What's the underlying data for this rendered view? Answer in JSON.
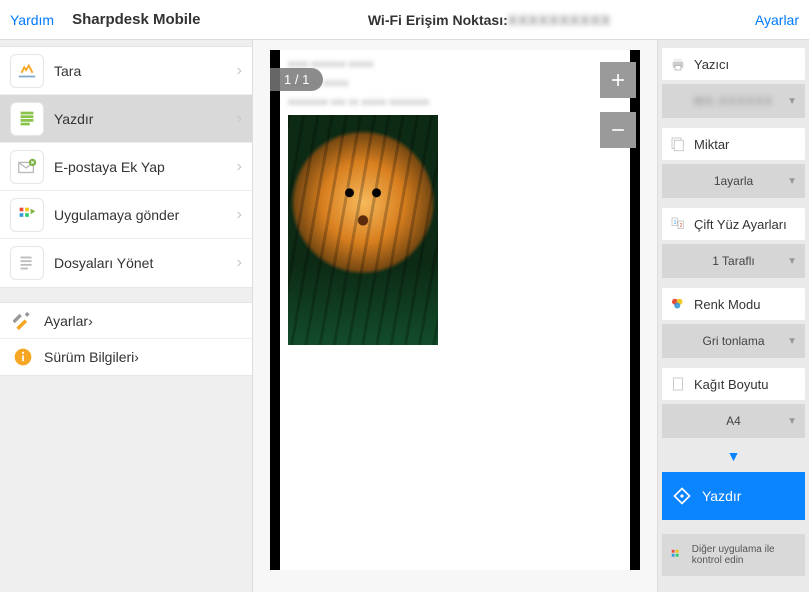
{
  "header": {
    "help": "Yardım",
    "appTitle": "Sharpdesk Mobile",
    "wifiLabel": "Wi-Fi Erişim Noktası:",
    "wifiValue": "XXXXXXXXXX",
    "settings": "Ayarlar"
  },
  "sidebar": {
    "main": [
      {
        "label": "Tara",
        "icon": "scan"
      },
      {
        "label": "Yazdır",
        "icon": "print",
        "selected": true
      },
      {
        "label": "E-postaya Ek Yap",
        "icon": "email"
      },
      {
        "label": "Uygulamaya gönder",
        "icon": "send-app"
      },
      {
        "label": "Dosyaları Yönet",
        "icon": "files"
      }
    ],
    "secondary": [
      {
        "label": "Ayarlar",
        "icon": "tools"
      },
      {
        "label": "Sürüm Bilgileri",
        "icon": "info"
      }
    ]
  },
  "preview": {
    "pageCounter": "1 / 1",
    "metaLines": [
      "xxxx xxxxxxx xxxxx",
      "xxxx xx xxxxx",
      "xxxxxxxx xxx xx xxxxx xxxxxxxx"
    ]
  },
  "settings": {
    "printer": {
      "label": "Yazıcı",
      "value": "MX-XXXXXX"
    },
    "quantity": {
      "label": "Miktar",
      "value": "1ayarla"
    },
    "duplex": {
      "label": "Çift Yüz Ayarları",
      "value": "1 Taraflı"
    },
    "color": {
      "label": "Renk Modu",
      "value": "Gri tonlama"
    },
    "paper": {
      "label": "Kağıt Boyutu",
      "value": "A4"
    },
    "printBtn": "Yazdır",
    "otherApp": "Diğer uygulama ile kontrol edin"
  }
}
